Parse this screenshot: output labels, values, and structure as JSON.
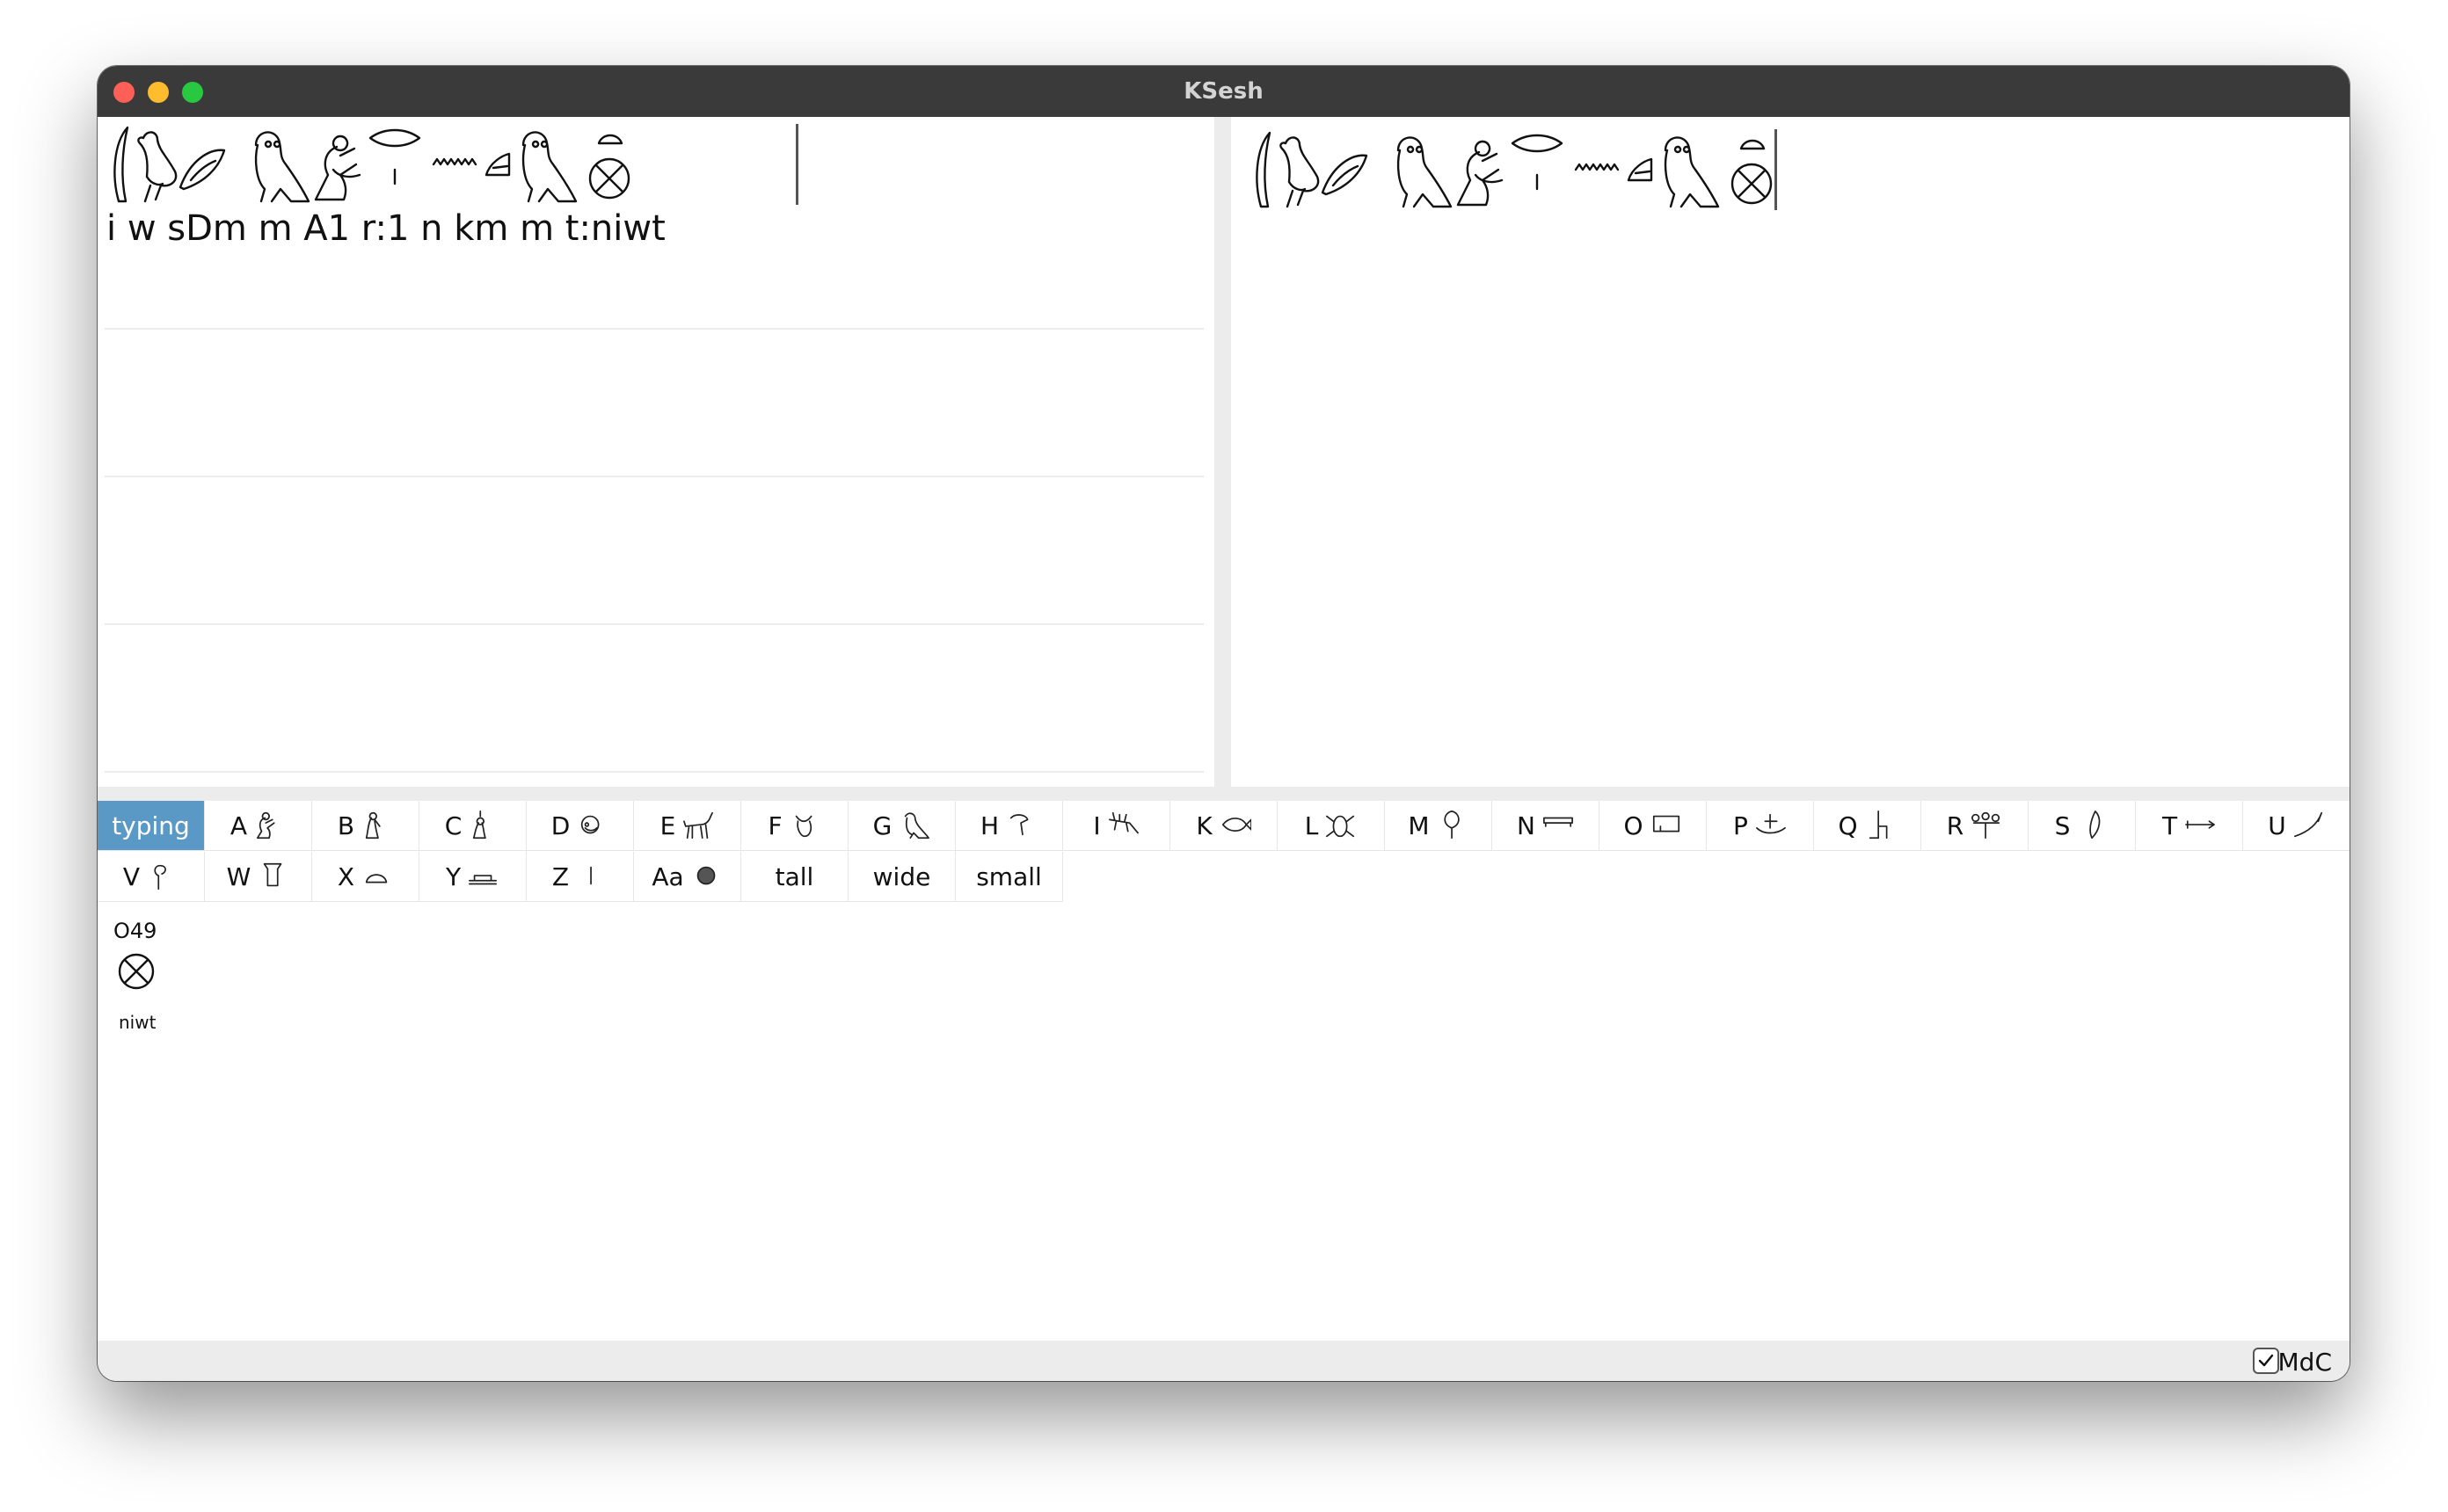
{
  "window": {
    "title": "KSesh"
  },
  "editor": {
    "mdc_text": "i w sDm m A1 r:1 n km m t:niwt",
    "glyph_sequence": [
      "reed-leaf",
      "quail-chick",
      "ear",
      "owl",
      "seated-man",
      "mouth-over-stroke",
      "water-ripple",
      "bread-loaf",
      "owl",
      "bread-over-city"
    ]
  },
  "preview": {
    "glyph_sequence": [
      "reed-leaf",
      "quail-chick",
      "ear",
      "owl",
      "seated-man",
      "mouth-over-stroke",
      "water-ripple",
      "bread-loaf",
      "owl",
      "bread-over-city"
    ]
  },
  "tabs": {
    "row1": [
      {
        "label": "typing",
        "selected": true,
        "icon": ""
      },
      {
        "label": "A",
        "icon": "seated-man-icon"
      },
      {
        "label": "B",
        "icon": "seated-woman-icon"
      },
      {
        "label": "C",
        "icon": "deity-icon"
      },
      {
        "label": "D",
        "icon": "head-icon"
      },
      {
        "label": "E",
        "icon": "animal-icon"
      },
      {
        "label": "F",
        "icon": "animal-part-icon"
      },
      {
        "label": "G",
        "icon": "bird-icon"
      },
      {
        "label": "H",
        "icon": "bird-part-icon"
      },
      {
        "label": "I",
        "icon": "reptile-icon"
      },
      {
        "label": "K",
        "icon": "fish-icon"
      },
      {
        "label": "L",
        "icon": "insect-icon"
      },
      {
        "label": "M",
        "icon": "tree-icon"
      },
      {
        "label": "N",
        "icon": "sky-icon"
      },
      {
        "label": "O",
        "icon": "building-icon"
      },
      {
        "label": "P",
        "icon": "ship-icon"
      },
      {
        "label": "Q",
        "icon": "furniture-icon"
      },
      {
        "label": "R",
        "icon": "temple-furniture-icon"
      },
      {
        "label": "S",
        "icon": "crown-icon"
      },
      {
        "label": "T",
        "icon": "weapon-icon"
      },
      {
        "label": "U",
        "icon": "agriculture-icon"
      }
    ],
    "row2": [
      {
        "label": "V",
        "icon": "rope-icon"
      },
      {
        "label": "W",
        "icon": "vessel-icon"
      },
      {
        "label": "X",
        "icon": "bread-icon"
      },
      {
        "label": "Y",
        "icon": "writing-icon"
      },
      {
        "label": "Z",
        "icon": "stroke-icon"
      },
      {
        "label": "Aa",
        "icon": "unclassified-icon"
      },
      {
        "label": "tall",
        "icon": ""
      },
      {
        "label": "wide",
        "icon": ""
      },
      {
        "label": "small",
        "icon": ""
      }
    ]
  },
  "palette": {
    "sign_code": "O49",
    "sign_label": "niwt",
    "sign_icon": "city-icon"
  },
  "status": {
    "mdc_label": "MdC",
    "mdc_checked": true
  }
}
